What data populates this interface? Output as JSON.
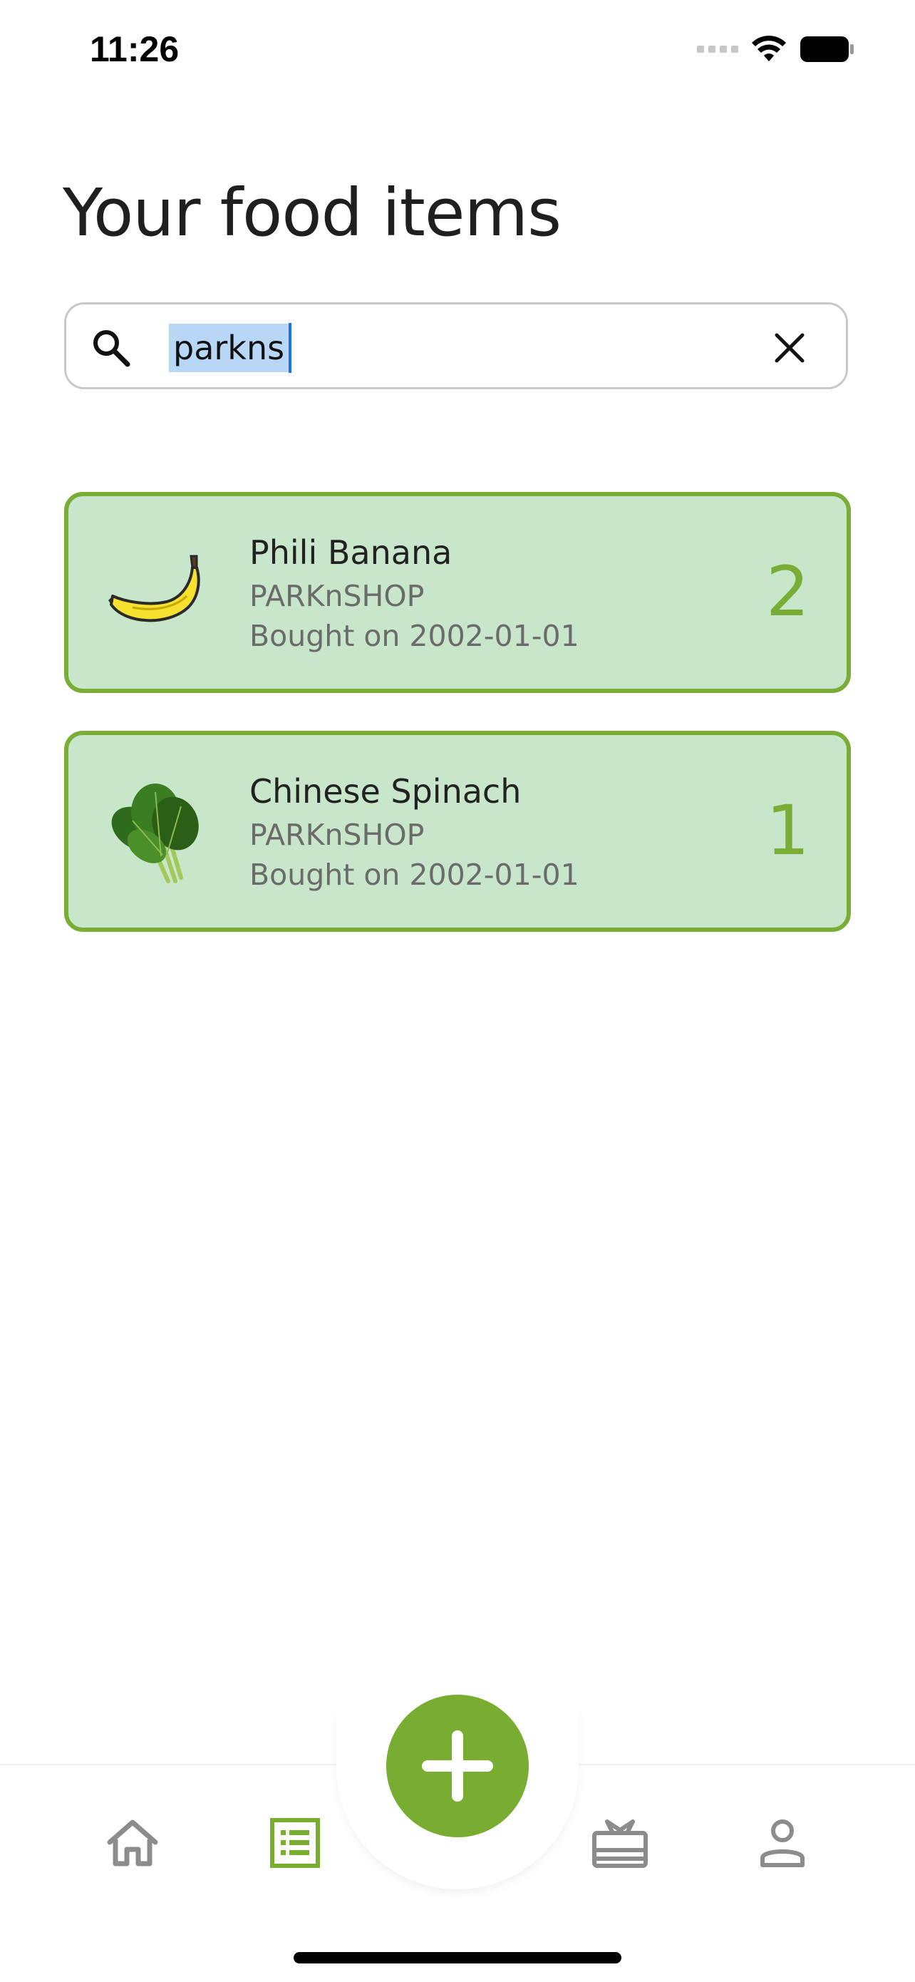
{
  "status_bar": {
    "time": "11:26"
  },
  "title": "Your food items",
  "search": {
    "value": "parkns"
  },
  "items": [
    {
      "name": "Phili Banana",
      "store": "PARKnSHOP",
      "date": "Bought on 2002-01-01",
      "quantity": "2",
      "icon": "banana-icon"
    },
    {
      "name": "Chinese Spinach",
      "store": "PARKnSHOP",
      "date": "Bought on 2002-01-01",
      "quantity": "1",
      "icon": "spinach-icon"
    }
  ],
  "nav": {
    "items": [
      "home-icon",
      "list-icon",
      "add-icon",
      "gift-icon",
      "profile-icon"
    ],
    "active": "list-icon"
  },
  "colors": {
    "accent": "#78ad32",
    "card_bg": "#c8e6c9",
    "card_border": "#7aad35",
    "selection": "#b8d7f7"
  }
}
